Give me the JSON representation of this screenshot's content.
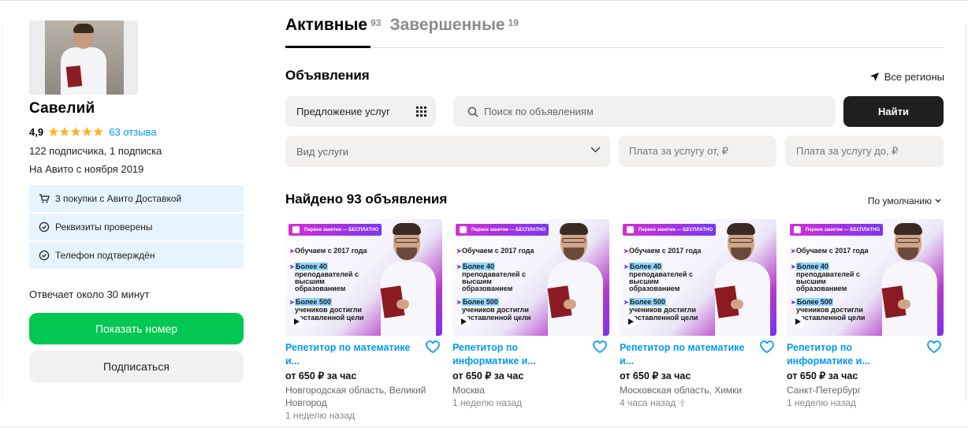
{
  "profile": {
    "name": "Савелий",
    "rating": "4,9",
    "stars": "★★★★★",
    "reviews": "63 отзыва",
    "subscribers": "122 подписчика, 1 подписка",
    "since": "На Авито с ноября 2019",
    "badges": [
      {
        "icon": "cart-icon",
        "label": "3 покупки с Авито Доставкой"
      },
      {
        "icon": "check-circle-icon",
        "label": "Реквизиты проверены"
      },
      {
        "icon": "check-circle-icon",
        "label": "Телефон подтверждён"
      }
    ],
    "replies": "Отвечает около 30 минут",
    "show_number": "Показать номер",
    "subscribe": "Подписаться"
  },
  "tabs": [
    {
      "label": "Активные",
      "count": "93"
    },
    {
      "label": "Завершенные",
      "count": "19"
    }
  ],
  "section_title": "Объявления",
  "regions": "Все регионы",
  "filters": {
    "category": "Предложение услуг",
    "search_placeholder": "Поиск по объявлениям",
    "find": "Найти",
    "service_placeholder": "Вид услуги",
    "price_from_placeholder": "Плата за услугу от, ₽",
    "price_to_placeholder": "Плата за услугу до, ₽"
  },
  "found": "Найдено 93 объявления",
  "sort": "По умолчанию",
  "banner": {
    "top": "Первое занятие — БЕСПЛАТНО",
    "lines": [
      "Обучаем с 2017 года",
      "Более 40",
      "преподавателей с",
      "высшим",
      "образованием",
      "Более 500",
      "учеников достигли",
      "поставленной цели"
    ]
  },
  "cards": [
    {
      "title": "Репетитор по математике и...",
      "price": "от 650 ₽ за час",
      "location": "Новгородская область, Великий Новгород",
      "time": "1 неделю назад",
      "boost": false
    },
    {
      "title": "Репетитор по информатике и...",
      "price": "от 650 ₽ за час",
      "location": "Москва",
      "time": "1 неделю назад",
      "boost": false
    },
    {
      "title": "Репетитор по математике и...",
      "price": "от 650 ₽ за час",
      "location": "Московская область, Химки",
      "time": "4 часа назад",
      "boost": true
    },
    {
      "title": "Репетитор по информатике и...",
      "price": "от 650 ₽ за час",
      "location": "Санкт-Петербург",
      "time": "1 неделю назад",
      "boost": false
    }
  ],
  "colors": {
    "accent_blue": "#0099f7",
    "green": "#00c853",
    "star": "#ffb021"
  }
}
